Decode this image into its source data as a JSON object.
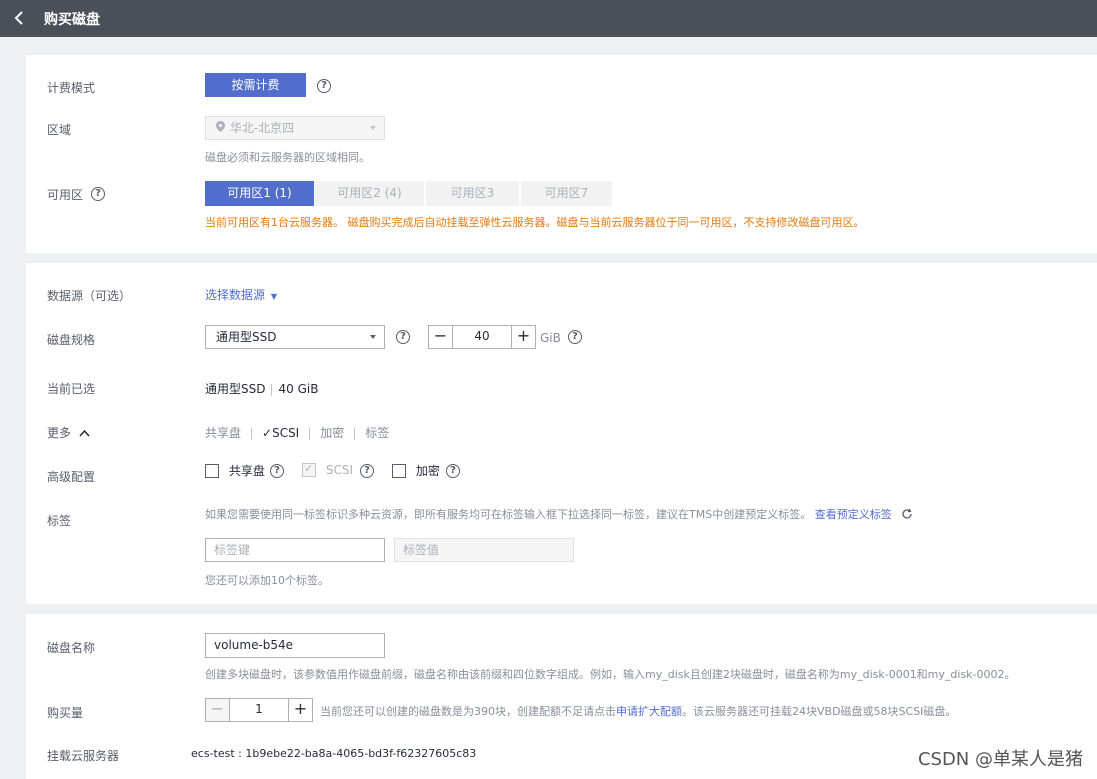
{
  "header": {
    "title": "购买磁盘"
  },
  "billing": {
    "label": "计费模式",
    "button": "按需计费"
  },
  "region": {
    "label": "区域",
    "value": "华北-北京四",
    "hint": "磁盘必须和云服务器的区域相同。"
  },
  "az": {
    "label": "可用区",
    "tabs": [
      "可用区1 (1)",
      "可用区2 (4)",
      "可用区3",
      "可用区7"
    ],
    "warning": "当前可用区有1台云服务器。 磁盘购买完成后自动挂载至弹性云服务器。磁盘与当前云服务器位于同一可用区，不支持修改磁盘可用区。"
  },
  "datasource": {
    "label": "数据源（可选）",
    "link": "选择数据源"
  },
  "spec": {
    "label": "磁盘规格",
    "type": "通用型SSD",
    "size": "40",
    "unit": "GiB"
  },
  "current": {
    "label": "当前已选",
    "type": "通用型SSD",
    "size": "40 GiB"
  },
  "more": {
    "label": "更多",
    "items": [
      "共享盘",
      "✓SCSI",
      "加密",
      "标签"
    ]
  },
  "advanced": {
    "label": "高级配置",
    "shared": "共享盘",
    "scsi": "SCSI",
    "encrypt": "加密"
  },
  "tags": {
    "label": "标签",
    "hint": "如果您需要使用同一标签标识多种云资源，即所有服务均可在标签输入框下拉选择同一标签，建议在TMS中创建预定义标签。",
    "link": "查看预定义标签",
    "key_placeholder": "标签键",
    "value_placeholder": "标签值",
    "limit": "您还可以添加10个标签。"
  },
  "disk_name": {
    "label": "磁盘名称",
    "value": "volume-b54e",
    "hint": "创建多块磁盘时，该参数值用作磁盘前缀，磁盘名称由该前缀和四位数字组成。例如，输入my_disk且创建2块磁盘时，磁盘名称为my_disk-0001和my_disk-0002。"
  },
  "quantity": {
    "label": "购买量",
    "value": "1",
    "hint_pre": "当前您还可以创建的磁盘数是为390块，创建配额不足请点击",
    "link": "申请扩大配额",
    "hint_post": "。该云服务器还可挂载24块VBD磁盘或58块SCSI磁盘。"
  },
  "attach": {
    "label": "挂载云服务器",
    "value": "ecs-test : 1b9ebe22-ba8a-4065-bd3f-f62327605c83"
  },
  "watermark": "CSDN @单某人是猪"
}
